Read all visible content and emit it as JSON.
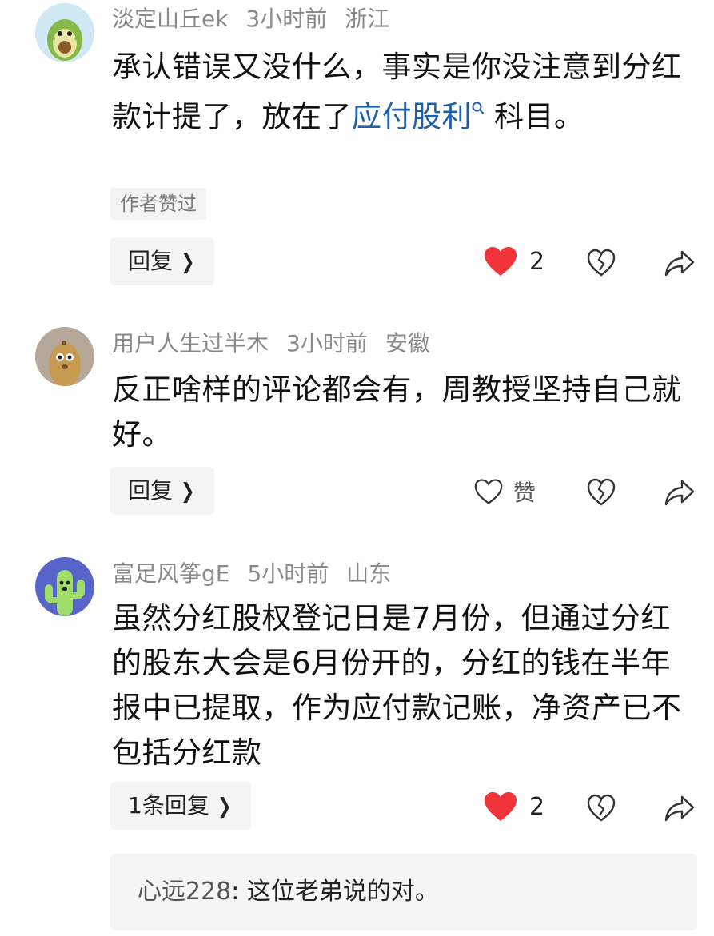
{
  "comments": [
    {
      "username": "淡定山丘ek",
      "time": "3小时前",
      "location": "浙江",
      "text_part1": "承认错误又没什么，事实是你没注意到分红款计提了，放在了",
      "link_text": "应付股利",
      "text_part2": "科目。",
      "author_tag": "作者赞过",
      "reply_label": "回复",
      "like_count": "2",
      "liked": true
    },
    {
      "username": "用户人生过半木",
      "time": "3小时前",
      "location": "安徽",
      "text": "反正啥样的评论都会有，周教授坚持自己就好。",
      "reply_label": "回复",
      "like_label": "赞",
      "liked": false
    },
    {
      "username": "富足风筝gE",
      "time": "5小时前",
      "location": "山东",
      "text": "虽然分红股权登记日是7月份，但通过分红的股东大会是6月份开的，分红的钱在半年报中已提取，作为应付款记账，净资产已不包括分红款",
      "reply_label": "1条回复",
      "like_count": "2",
      "liked": true,
      "sub_reply": {
        "author": "心远228",
        "separator": ": ",
        "text": "这位老弟说的对。"
      }
    }
  ],
  "colors": {
    "like_red": "#f0343a",
    "link_blue": "#1f5fa8",
    "meta_gray": "#8a8a8a"
  },
  "icons": [
    "heart-filled-icon",
    "heart-outline-icon",
    "broken-heart-icon",
    "share-icon",
    "chevron-right-icon",
    "search-icon"
  ]
}
